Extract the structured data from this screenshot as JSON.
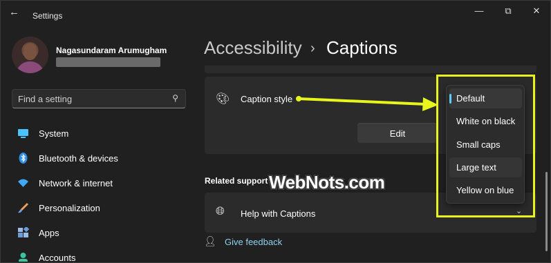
{
  "window": {
    "title": "Settings",
    "back_glyph": "←",
    "minimize_glyph": "—",
    "maximize_glyph": "⧉",
    "close_glyph": "✕"
  },
  "profile": {
    "name": "Nagasundaram Arumugham"
  },
  "search": {
    "placeholder": "Find a setting"
  },
  "sidebar": {
    "items": [
      {
        "label": "System",
        "icon": "monitor-icon",
        "color": "#4cc2ff"
      },
      {
        "label": "Bluetooth & devices",
        "icon": "bluetooth-icon",
        "color": "#2f8fe8"
      },
      {
        "label": "Network & internet",
        "icon": "wifi-icon",
        "color": "#3fa9f5"
      },
      {
        "label": "Personalization",
        "icon": "brush-icon",
        "color": "#e8a35c"
      },
      {
        "label": "Apps",
        "icon": "apps-icon",
        "color": "#6b9bd8"
      },
      {
        "label": "Accounts",
        "icon": "account-icon",
        "color": "#3cc4a0"
      }
    ]
  },
  "breadcrumb": {
    "parent": "Accessibility",
    "separator": "›",
    "current": "Captions"
  },
  "caption_card": {
    "label": "Caption style",
    "edit_label": "Edit"
  },
  "caption_style_options": {
    "selected": "Default",
    "items": [
      "Default",
      "White on black",
      "Small caps",
      "Large text",
      "Yellow on blue"
    ]
  },
  "related": {
    "title": "Related support",
    "help_label": "Help with Captions"
  },
  "feedback": {
    "label": "Give feedback"
  },
  "watermark": {
    "text": "WebNots.com"
  },
  "colors": {
    "accent": "#60cdff",
    "annotation": "#e8f51c",
    "background": "#202020",
    "card": "#2b2b2b"
  }
}
